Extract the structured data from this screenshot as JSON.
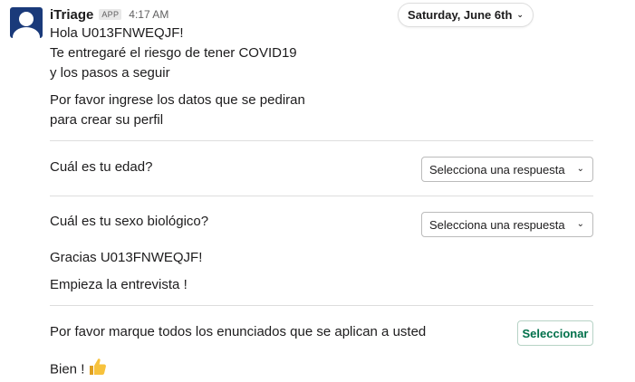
{
  "message": {
    "sender": "iTriage",
    "badge": "APP",
    "time": "4:17 AM",
    "date_label": "Saturday, June 6th",
    "greeting": "Hola U013FNWEQJF!",
    "intro_line1": "Te entregaré el riesgo de tener COVID19",
    "intro_line2": "y los pasos a seguir",
    "data_line1": "Por favor ingrese los datos que se pediran",
    "data_line2": "para crear su perfil",
    "age_question": "Cuál es tu edad?",
    "age_select_value": "Selecciona una respuesta",
    "sex_question": "Cuál es tu sexo biológico?",
    "sex_select_value": "Selecciona una respuesta",
    "thanks": "Gracias U013FNWEQJF!",
    "interview": "Empieza la entrevista !",
    "statements_prompt": "Por favor marque todos los enunciados que se aplican a usted",
    "select_button": "Seleccionar",
    "ok_text": "Bien !"
  },
  "icons": {
    "chevron": "chevron-down-icon",
    "thumbs_up": "thumbs-up-icon"
  },
  "colors": {
    "button_text": "#00704a",
    "avatar_bg": "#1a3a7a"
  }
}
